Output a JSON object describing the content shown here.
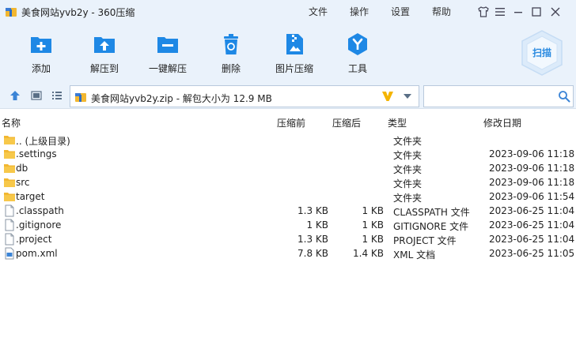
{
  "window": {
    "title": "美食网站yvb2y - 360压缩",
    "menu": [
      "文件",
      "操作",
      "设置",
      "帮助"
    ]
  },
  "toolbar": {
    "items": [
      {
        "label": "添加",
        "icon": "add-icon"
      },
      {
        "label": "解压到",
        "icon": "extract-to-icon"
      },
      {
        "label": "一键解压",
        "icon": "one-click-extract-icon"
      },
      {
        "label": "删除",
        "icon": "delete-icon"
      },
      {
        "label": "图片压缩",
        "icon": "image-compress-icon"
      },
      {
        "label": "工具",
        "icon": "tools-icon"
      }
    ],
    "scan_label": "扫描"
  },
  "address": {
    "text": "美食网站yvb2y.zip - 解包大小为 12.9 MB"
  },
  "search": {
    "placeholder": ""
  },
  "columns": {
    "name": "名称",
    "compressed": "压缩前",
    "packed": "压缩后",
    "type": "类型",
    "date": "修改日期"
  },
  "files": [
    {
      "name": ".. (上级目录)",
      "icon": "folder-icon",
      "compressed": "",
      "packed": "",
      "type": "文件夹",
      "date": ""
    },
    {
      "name": ".settings",
      "icon": "folder-icon",
      "compressed": "",
      "packed": "",
      "type": "文件夹",
      "date": "2023-09-06 11:18"
    },
    {
      "name": "db",
      "icon": "folder-icon",
      "compressed": "",
      "packed": "",
      "type": "文件夹",
      "date": "2023-09-06 11:18"
    },
    {
      "name": "src",
      "icon": "folder-icon",
      "compressed": "",
      "packed": "",
      "type": "文件夹",
      "date": "2023-09-06 11:18"
    },
    {
      "name": "target",
      "icon": "folder-icon",
      "compressed": "",
      "packed": "",
      "type": "文件夹",
      "date": "2023-09-06 11:54"
    },
    {
      "name": ".classpath",
      "icon": "file-icon",
      "compressed": "1.3 KB",
      "packed": "1 KB",
      "type": "CLASSPATH 文件",
      "date": "2023-06-25 11:04"
    },
    {
      "name": ".gitignore",
      "icon": "file-icon",
      "compressed": "1 KB",
      "packed": "1 KB",
      "type": "GITIGNORE 文件",
      "date": "2023-06-25 11:04"
    },
    {
      "name": ".project",
      "icon": "file-icon",
      "compressed": "1.3 KB",
      "packed": "1 KB",
      "type": "PROJECT 文件",
      "date": "2023-06-25 11:04"
    },
    {
      "name": "pom.xml",
      "icon": "xml-file-icon",
      "compressed": "7.8 KB",
      "packed": "1.4 KB",
      "type": "XML 文档",
      "date": "2023-06-25 11:05"
    }
  ],
  "colors": {
    "accent": "#1e88e5",
    "toolbar_bg": "#eaf2fb",
    "folder": "#f2b731",
    "v_mark": "#f4b400"
  }
}
